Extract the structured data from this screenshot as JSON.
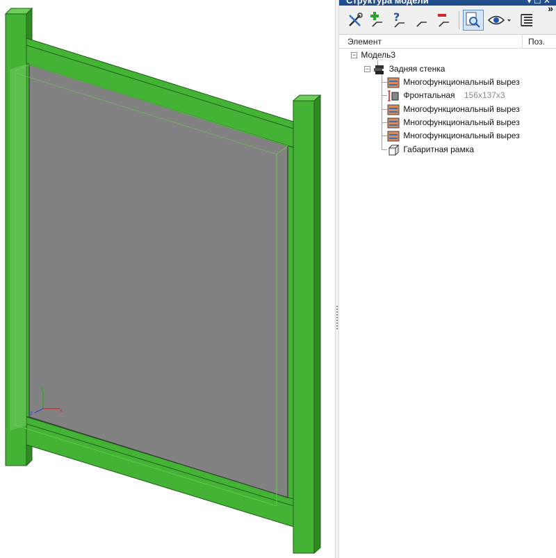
{
  "panel": {
    "title": "Структура модели",
    "title_controls": "▾ ☐ ✕",
    "more": "»"
  },
  "toolbar": {
    "buttons": [
      {
        "icon": "tools-icon"
      },
      {
        "icon": "add-element-icon"
      },
      {
        "icon": "query-element-icon"
      },
      {
        "icon": "connect-icon"
      },
      {
        "icon": "remove-element-icon"
      },
      {
        "icon": "zoom-to-element-icon",
        "active": true
      },
      {
        "icon": "visibility-eye-icon"
      },
      {
        "icon": "list-view-icon"
      }
    ]
  },
  "columns": {
    "element": "Элемент",
    "position": "Поз."
  },
  "tree": {
    "root": {
      "label": "Модель3",
      "expanded": true
    },
    "assembly": {
      "label": "Задняя стенка",
      "expanded": true
    },
    "children": [
      {
        "label": "Многофункциональный вырез",
        "icon": "multi-cut-icon"
      },
      {
        "label": "Фронтальная",
        "dims": "156x137x3",
        "icon": "frontal-panel-icon"
      },
      {
        "label": "Многофункциональный вырез",
        "icon": "multi-cut-icon"
      },
      {
        "label": "Многофункциональный вырез",
        "icon": "multi-cut-icon"
      },
      {
        "label": "Многофункциональный вырез",
        "icon": "multi-cut-icon"
      },
      {
        "label": "Габаритная рамка",
        "icon": "bounding-frame-icon"
      }
    ]
  },
  "viewport": {
    "frame_color": "#44b234",
    "panel_color": "#828282",
    "axis_labels": {
      "z": "z",
      "x": "x",
      "y": "y"
    }
  }
}
